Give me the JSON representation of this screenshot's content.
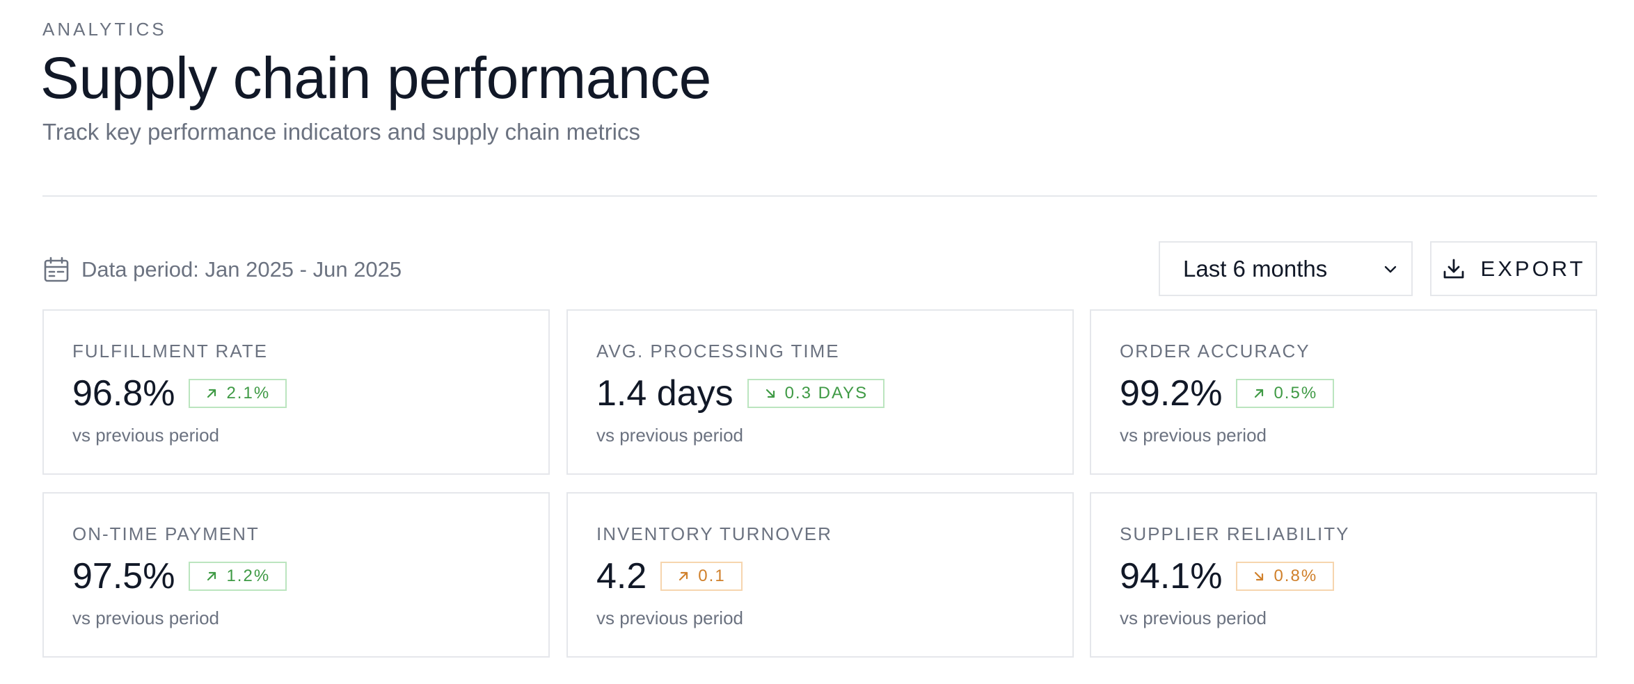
{
  "header": {
    "eyebrow": "ANALYTICS",
    "title": "Supply chain performance",
    "subtitle": "Track key performance indicators and supply chain metrics"
  },
  "toolbar": {
    "period_text": "Data period: Jan 2025 - Jun 2025",
    "range_value": "Last 6 months",
    "export_label": "EXPORT",
    "icons": {
      "period": "calendar-icon",
      "range": "chevron-down-icon",
      "export": "download-icon"
    }
  },
  "colors": {
    "positive": "#3f9a45",
    "positive_border": "#bbe5bf",
    "warning": "#d0802b",
    "warning_border": "#f6d5ae",
    "muted_text": "#6b7280",
    "border": "#e5e7eb"
  },
  "metrics": [
    {
      "label": "FULFILLMENT RATE",
      "value": "96.8%",
      "change": "2.1%",
      "direction": "up",
      "status": "good",
      "caption": "vs previous period"
    },
    {
      "label": "AVG. PROCESSING TIME",
      "value": "1.4 days",
      "change": "0.3 DAYS",
      "direction": "down",
      "status": "good",
      "caption": "vs previous period"
    },
    {
      "label": "ORDER ACCURACY",
      "value": "99.2%",
      "change": "0.5%",
      "direction": "up",
      "status": "good",
      "caption": "vs previous period"
    },
    {
      "label": "ON-TIME PAYMENT",
      "value": "97.5%",
      "change": "1.2%",
      "direction": "up",
      "status": "good",
      "caption": "vs previous period"
    },
    {
      "label": "INVENTORY TURNOVER",
      "value": "4.2",
      "change": "0.1",
      "direction": "up",
      "status": "warn",
      "caption": "vs previous period"
    },
    {
      "label": "SUPPLIER RELIABILITY",
      "value": "94.1%",
      "change": "0.8%",
      "direction": "down",
      "status": "warn",
      "caption": "vs previous period"
    }
  ]
}
